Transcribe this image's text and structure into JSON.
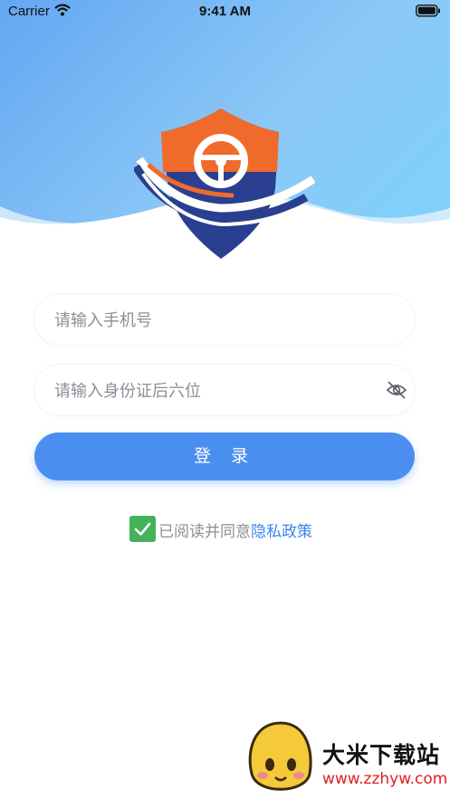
{
  "status_bar": {
    "carrier": "Carrier",
    "time": "9:41 AM",
    "icons": [
      "wifi-icon",
      "battery-icon"
    ]
  },
  "logo": {
    "icon": "shield-steering-wheel-logo",
    "colors": {
      "orange": "#f06a2c",
      "navy": "#2a3f8f"
    }
  },
  "form": {
    "phone_placeholder": "请输入手机号",
    "id_placeholder": "请输入身份证后六位",
    "id_visibility_icon": "eye-slash-icon",
    "login_label": "登 录"
  },
  "agreement": {
    "checked": true,
    "text": "已阅读并同意",
    "link": "隐私政策"
  },
  "watermark": {
    "title": "大米下载站",
    "url": "www.zzhyw.com"
  },
  "colors": {
    "accent": "#4a8ff0",
    "check": "#43b25a",
    "link": "#3d86ea"
  }
}
